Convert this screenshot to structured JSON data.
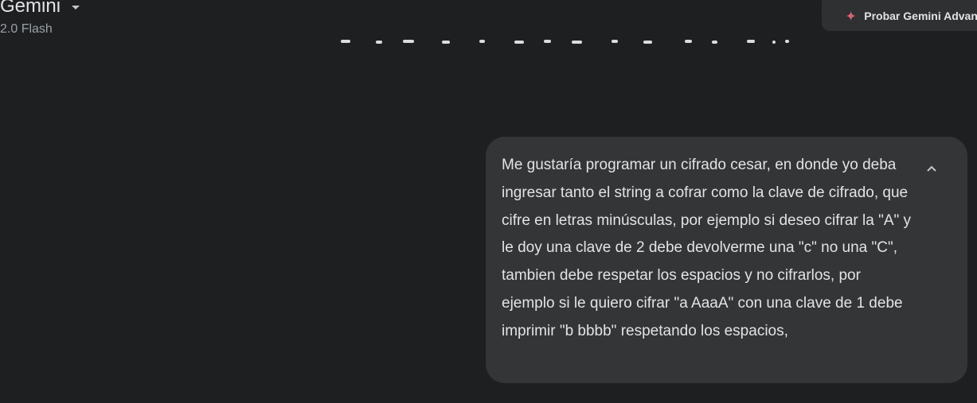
{
  "header": {
    "app_title": "Gemini",
    "model_name": "2.0 Flash",
    "upgrade_label": "Probar Gemini Advanced",
    "accent_color": "#d96570"
  },
  "chat": {
    "user_message": "Me gustaría programar un cifrado cesar, en donde yo deba ingresar tanto el string a cofrar como la clave de cifrado, que cifre en letras minúsculas, por ejemplo si deseo cifrar la \"A\" y le doy una clave de 2 debe devolverme una \"c\" no una \"C\", tambien debe respetar los espacios y no cifrarlos, por ejemplo si le quiero cifrar \"a AaaA\" con una clave de 1 debe imprimir \"b bbbb\" respetando los espacios,",
    "collapse_icon": "chevron-up-icon"
  }
}
